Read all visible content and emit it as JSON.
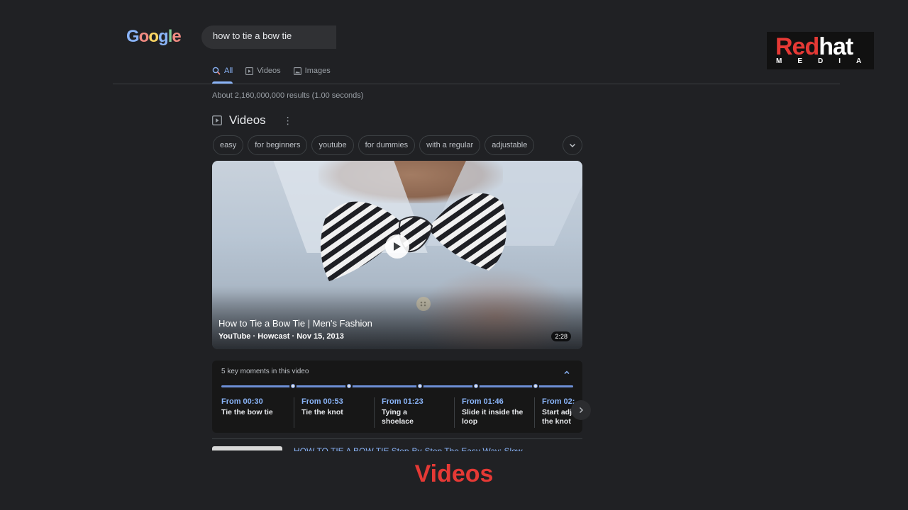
{
  "logo": {
    "letters": [
      "G",
      "o",
      "o",
      "g",
      "l",
      "e"
    ]
  },
  "search": {
    "query": "how to tie a bow tie"
  },
  "tabs": [
    {
      "label": "All",
      "icon": "search-icon",
      "active": true
    },
    {
      "label": "Videos",
      "icon": "video-icon",
      "active": false
    },
    {
      "label": "Images",
      "icon": "image-icon",
      "active": false
    }
  ],
  "results_count": "About 2,160,000,000 results (1.00 seconds)",
  "videos_section": {
    "title": "Videos",
    "chips": [
      "easy",
      "for beginners",
      "youtube",
      "for dummies",
      "with a regular",
      "adjustable"
    ]
  },
  "video": {
    "title": "How to Tie a Bow Tie | Men's Fashion",
    "meta": "YouTube · Howcast · Nov 15, 2013",
    "duration": "2:28"
  },
  "key_moments": {
    "title": "5 key moments in this video",
    "items": [
      {
        "time": "From 00:30",
        "label": "Tie the bow tie"
      },
      {
        "time": "From 00:53",
        "label": "Tie the knot"
      },
      {
        "time": "From 01:23",
        "label": "Tying a shoelace"
      },
      {
        "time": "From 01:46",
        "label": "Slide it inside the loop"
      },
      {
        "time": "From 02:",
        "label": "Start adj the knot"
      }
    ]
  },
  "next_result": {
    "title": "HOW TO TIE A BOW TIE Step-By-Step The Easy Way: Slow"
  },
  "watermark": {
    "red": "Red",
    "white": "hat",
    "sub": "MEDIA"
  },
  "caption": "Videos",
  "colors": {
    "accent": "#8ab4f8",
    "background": "#202124",
    "brand_red": "#e53935"
  }
}
